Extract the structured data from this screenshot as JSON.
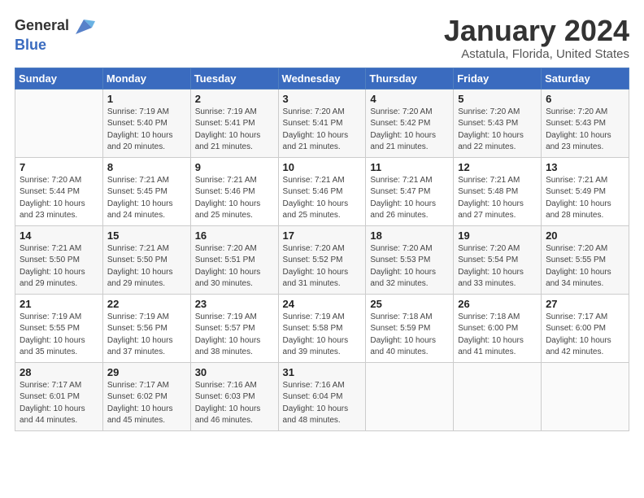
{
  "logo": {
    "line1": "General",
    "line2": "Blue"
  },
  "title": "January 2024",
  "subtitle": "Astatula, Florida, United States",
  "headers": [
    "Sunday",
    "Monday",
    "Tuesday",
    "Wednesday",
    "Thursday",
    "Friday",
    "Saturday"
  ],
  "weeks": [
    [
      {
        "num": "",
        "sunrise": "",
        "sunset": "",
        "daylight": ""
      },
      {
        "num": "1",
        "sunrise": "Sunrise: 7:19 AM",
        "sunset": "Sunset: 5:40 PM",
        "daylight": "Daylight: 10 hours and 20 minutes."
      },
      {
        "num": "2",
        "sunrise": "Sunrise: 7:19 AM",
        "sunset": "Sunset: 5:41 PM",
        "daylight": "Daylight: 10 hours and 21 minutes."
      },
      {
        "num": "3",
        "sunrise": "Sunrise: 7:20 AM",
        "sunset": "Sunset: 5:41 PM",
        "daylight": "Daylight: 10 hours and 21 minutes."
      },
      {
        "num": "4",
        "sunrise": "Sunrise: 7:20 AM",
        "sunset": "Sunset: 5:42 PM",
        "daylight": "Daylight: 10 hours and 21 minutes."
      },
      {
        "num": "5",
        "sunrise": "Sunrise: 7:20 AM",
        "sunset": "Sunset: 5:43 PM",
        "daylight": "Daylight: 10 hours and 22 minutes."
      },
      {
        "num": "6",
        "sunrise": "Sunrise: 7:20 AM",
        "sunset": "Sunset: 5:43 PM",
        "daylight": "Daylight: 10 hours and 23 minutes."
      }
    ],
    [
      {
        "num": "7",
        "sunrise": "Sunrise: 7:20 AM",
        "sunset": "Sunset: 5:44 PM",
        "daylight": "Daylight: 10 hours and 23 minutes."
      },
      {
        "num": "8",
        "sunrise": "Sunrise: 7:21 AM",
        "sunset": "Sunset: 5:45 PM",
        "daylight": "Daylight: 10 hours and 24 minutes."
      },
      {
        "num": "9",
        "sunrise": "Sunrise: 7:21 AM",
        "sunset": "Sunset: 5:46 PM",
        "daylight": "Daylight: 10 hours and 25 minutes."
      },
      {
        "num": "10",
        "sunrise": "Sunrise: 7:21 AM",
        "sunset": "Sunset: 5:46 PM",
        "daylight": "Daylight: 10 hours and 25 minutes."
      },
      {
        "num": "11",
        "sunrise": "Sunrise: 7:21 AM",
        "sunset": "Sunset: 5:47 PM",
        "daylight": "Daylight: 10 hours and 26 minutes."
      },
      {
        "num": "12",
        "sunrise": "Sunrise: 7:21 AM",
        "sunset": "Sunset: 5:48 PM",
        "daylight": "Daylight: 10 hours and 27 minutes."
      },
      {
        "num": "13",
        "sunrise": "Sunrise: 7:21 AM",
        "sunset": "Sunset: 5:49 PM",
        "daylight": "Daylight: 10 hours and 28 minutes."
      }
    ],
    [
      {
        "num": "14",
        "sunrise": "Sunrise: 7:21 AM",
        "sunset": "Sunset: 5:50 PM",
        "daylight": "Daylight: 10 hours and 29 minutes."
      },
      {
        "num": "15",
        "sunrise": "Sunrise: 7:21 AM",
        "sunset": "Sunset: 5:50 PM",
        "daylight": "Daylight: 10 hours and 29 minutes."
      },
      {
        "num": "16",
        "sunrise": "Sunrise: 7:20 AM",
        "sunset": "Sunset: 5:51 PM",
        "daylight": "Daylight: 10 hours and 30 minutes."
      },
      {
        "num": "17",
        "sunrise": "Sunrise: 7:20 AM",
        "sunset": "Sunset: 5:52 PM",
        "daylight": "Daylight: 10 hours and 31 minutes."
      },
      {
        "num": "18",
        "sunrise": "Sunrise: 7:20 AM",
        "sunset": "Sunset: 5:53 PM",
        "daylight": "Daylight: 10 hours and 32 minutes."
      },
      {
        "num": "19",
        "sunrise": "Sunrise: 7:20 AM",
        "sunset": "Sunset: 5:54 PM",
        "daylight": "Daylight: 10 hours and 33 minutes."
      },
      {
        "num": "20",
        "sunrise": "Sunrise: 7:20 AM",
        "sunset": "Sunset: 5:55 PM",
        "daylight": "Daylight: 10 hours and 34 minutes."
      }
    ],
    [
      {
        "num": "21",
        "sunrise": "Sunrise: 7:19 AM",
        "sunset": "Sunset: 5:55 PM",
        "daylight": "Daylight: 10 hours and 35 minutes."
      },
      {
        "num": "22",
        "sunrise": "Sunrise: 7:19 AM",
        "sunset": "Sunset: 5:56 PM",
        "daylight": "Daylight: 10 hours and 37 minutes."
      },
      {
        "num": "23",
        "sunrise": "Sunrise: 7:19 AM",
        "sunset": "Sunset: 5:57 PM",
        "daylight": "Daylight: 10 hours and 38 minutes."
      },
      {
        "num": "24",
        "sunrise": "Sunrise: 7:19 AM",
        "sunset": "Sunset: 5:58 PM",
        "daylight": "Daylight: 10 hours and 39 minutes."
      },
      {
        "num": "25",
        "sunrise": "Sunrise: 7:18 AM",
        "sunset": "Sunset: 5:59 PM",
        "daylight": "Daylight: 10 hours and 40 minutes."
      },
      {
        "num": "26",
        "sunrise": "Sunrise: 7:18 AM",
        "sunset": "Sunset: 6:00 PM",
        "daylight": "Daylight: 10 hours and 41 minutes."
      },
      {
        "num": "27",
        "sunrise": "Sunrise: 7:17 AM",
        "sunset": "Sunset: 6:00 PM",
        "daylight": "Daylight: 10 hours and 42 minutes."
      }
    ],
    [
      {
        "num": "28",
        "sunrise": "Sunrise: 7:17 AM",
        "sunset": "Sunset: 6:01 PM",
        "daylight": "Daylight: 10 hours and 44 minutes."
      },
      {
        "num": "29",
        "sunrise": "Sunrise: 7:17 AM",
        "sunset": "Sunset: 6:02 PM",
        "daylight": "Daylight: 10 hours and 45 minutes."
      },
      {
        "num": "30",
        "sunrise": "Sunrise: 7:16 AM",
        "sunset": "Sunset: 6:03 PM",
        "daylight": "Daylight: 10 hours and 46 minutes."
      },
      {
        "num": "31",
        "sunrise": "Sunrise: 7:16 AM",
        "sunset": "Sunset: 6:04 PM",
        "daylight": "Daylight: 10 hours and 48 minutes."
      },
      {
        "num": "",
        "sunrise": "",
        "sunset": "",
        "daylight": ""
      },
      {
        "num": "",
        "sunrise": "",
        "sunset": "",
        "daylight": ""
      },
      {
        "num": "",
        "sunrise": "",
        "sunset": "",
        "daylight": ""
      }
    ]
  ]
}
